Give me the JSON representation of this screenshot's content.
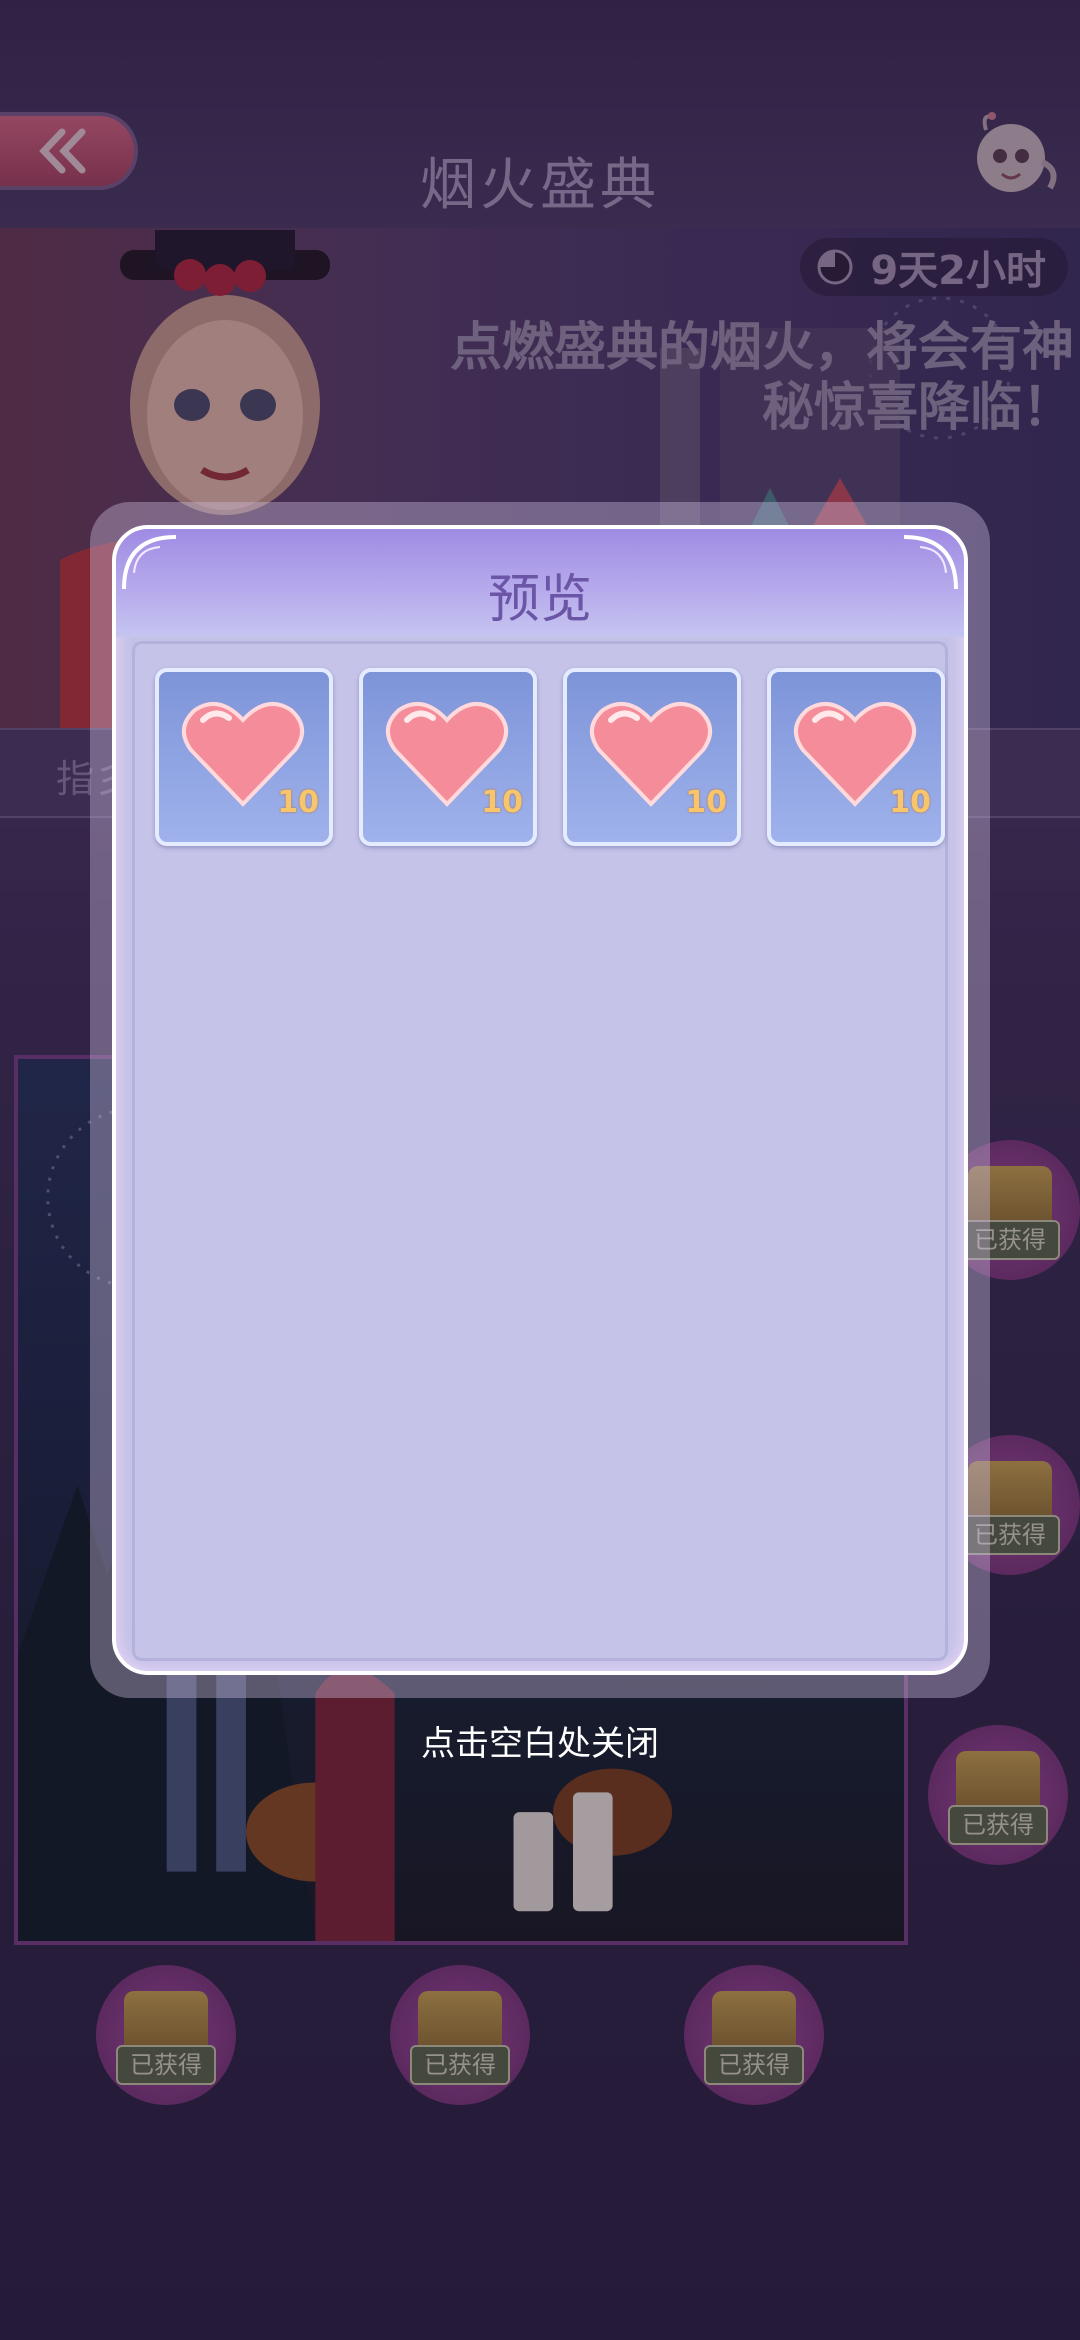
{
  "header": {
    "title": "烟火盛典",
    "back_icon": "double-chevron-left-icon"
  },
  "banner": {
    "timer": "9天2小时",
    "description_line1": "点燃盛典的烟火，将会有神",
    "description_line2": "秘惊喜降临！",
    "subtab": "指彡"
  },
  "rewards": {
    "obtained_label": "已获得"
  },
  "modal": {
    "title": "预览",
    "items": [
      {
        "icon": "heart-icon",
        "count": "10"
      },
      {
        "icon": "heart-icon",
        "count": "10"
      },
      {
        "icon": "heart-icon",
        "count": "10"
      },
      {
        "icon": "heart-icon",
        "count": "10"
      }
    ]
  },
  "close_hint": "点击空白处关闭",
  "colors": {
    "accent": "#6a55a6",
    "item_bg": "#8ea3e2",
    "heart": "#f38c99"
  }
}
